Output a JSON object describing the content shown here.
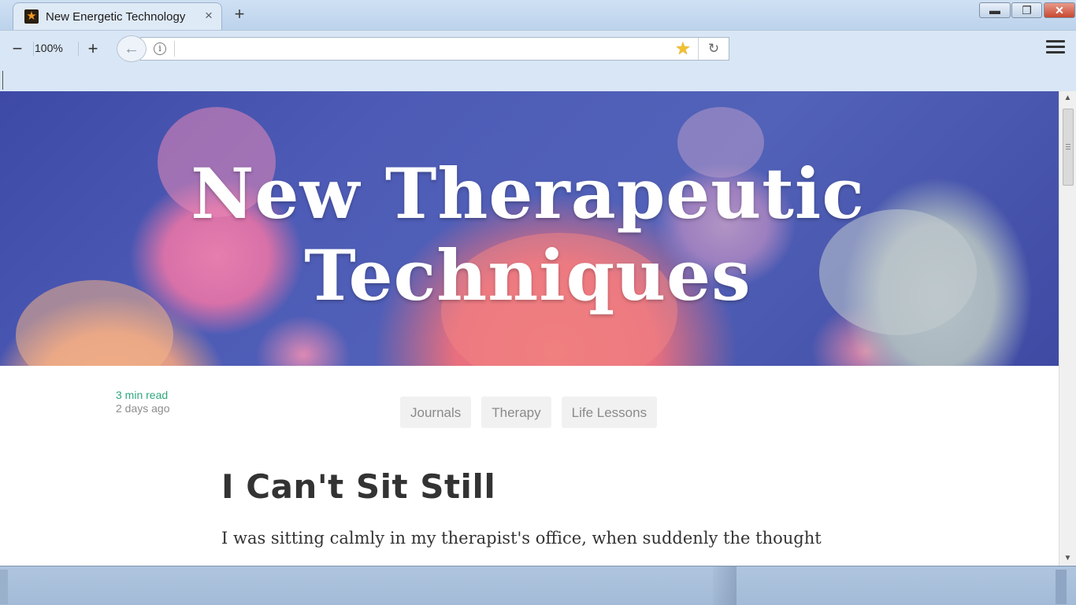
{
  "browser": {
    "tab_title": "New Energetic Technology",
    "tab_close": "×",
    "new_tab": "+",
    "zoom_out": "−",
    "zoom_level": "100%",
    "zoom_in": "+",
    "url_value": "",
    "info_icon": "i",
    "bookmark_star": "★",
    "reload": "↻",
    "back": "←",
    "window_minimize": "▬",
    "window_maximize": "❐",
    "window_close": "✕"
  },
  "icons": {
    "favicon": "star-favicon-icon",
    "back": "arrow-left-icon",
    "info": "info-icon",
    "bookmark": "star-icon",
    "reload": "reload-icon",
    "menu": "hamburger-menu-icon"
  },
  "page": {
    "hero_title": "New Therapeutic Techniques",
    "read_time": "3 min read",
    "posted": "2 days ago",
    "tags": [
      "Journals",
      "Therapy",
      "Life Lessons"
    ],
    "post_title": "I Can't Sit Still",
    "post_body": "I was sitting calmly in my therapist's office, when suddenly the thought"
  },
  "colors": {
    "read_time": "#2fa87a",
    "hero_bg": "#4d5bb6",
    "window_close": "#c8482f"
  }
}
